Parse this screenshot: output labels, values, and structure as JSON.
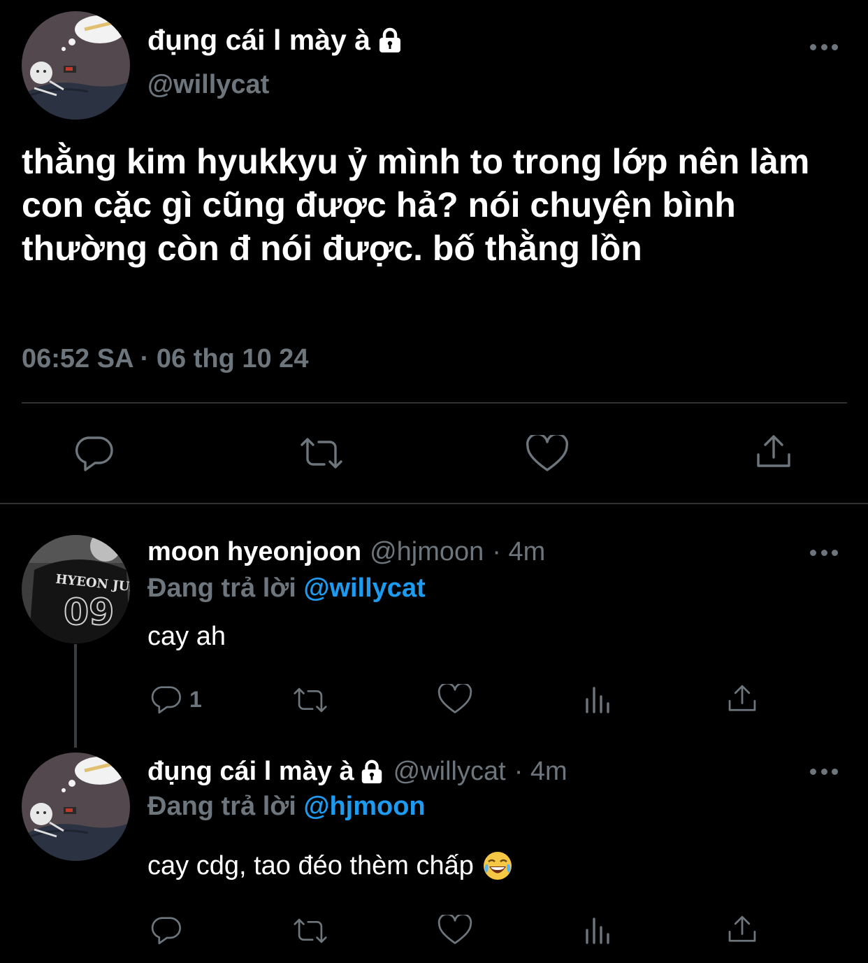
{
  "main_tweet": {
    "display_name": "đụng cái l mày à",
    "handle": "@willycat",
    "text": "thằng kim hyukkyu ỷ mình to trong lớp nên làm con cặc gì cũng được hả? nói chuyện bình thường còn đ nói được. bố thằng lồn",
    "timestamp": "06:52 SA · 06 thg 10 24",
    "icons": [
      "reply-icon",
      "retweet-icon",
      "like-icon",
      "share-icon"
    ]
  },
  "replies": [
    {
      "display_name": "moon hyeonjoon",
      "handle": "@hjmoon",
      "time": "· 4m",
      "replying_prefix": "Đang trả lời",
      "replying_to": "@willycat",
      "text": "cay ah",
      "reply_count": "1",
      "avatar_jersey_name": "HYEON JUN",
      "avatar_jersey_number": "09"
    },
    {
      "display_name": "đụng cái l mày à",
      "handle": "@willycat",
      "time": "· 4m",
      "replying_prefix": "Đang trả lời",
      "replying_to": "@hjmoon",
      "text": "cay cdg, tao đéo thèm chấp",
      "reply_count": ""
    }
  ],
  "colors": {
    "background": "#000000",
    "text": "#ffffff",
    "muted": "#6e767d",
    "link": "#1d9bf0",
    "divider": "#2f3336"
  }
}
